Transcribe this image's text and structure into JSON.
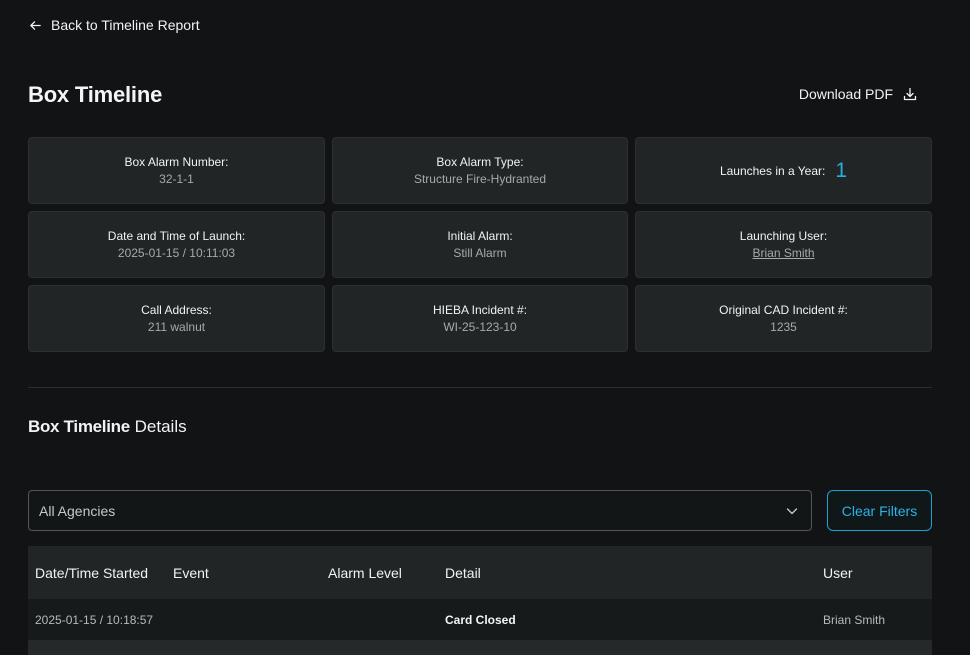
{
  "nav": {
    "back_label": "Back to Timeline Report"
  },
  "header": {
    "title": "Box Timeline",
    "download_label": "Download PDF"
  },
  "summary": {
    "box_alarm_number": {
      "label": "Box Alarm Number:",
      "value": "32-1-1"
    },
    "box_alarm_type": {
      "label": "Box Alarm Type:",
      "value": "Structure Fire-Hydranted"
    },
    "launches": {
      "label": "Launches in a Year:",
      "value": "1"
    },
    "launch_datetime": {
      "label": "Date and Time of Launch:",
      "value": "2025-01-15 / 10:11:03"
    },
    "initial_alarm": {
      "label": "Initial Alarm:",
      "value": "Still Alarm"
    },
    "launching_user": {
      "label": "Launching User:",
      "value": "Brian Smith"
    },
    "call_address": {
      "label": "Call Address:",
      "value": "211 walnut"
    },
    "hieba_incident": {
      "label": "HIEBA Incident #:",
      "value": "WI-25-123-10"
    },
    "cad_incident": {
      "label": "Original CAD Incident #:",
      "value": "1235"
    }
  },
  "details": {
    "title_bold": "Box Timeline",
    "title_rest": " Details"
  },
  "filters": {
    "agency_selected": "All Agencies",
    "clear_label": "Clear Filters"
  },
  "table": {
    "columns": {
      "started": "Date/Time Started",
      "event": "Event",
      "alarm_level": "Alarm Level",
      "detail": "Detail",
      "user": "User"
    },
    "rows": [
      {
        "started": "2025-01-15 / 10:18:57",
        "event": "",
        "alarm_level": "",
        "detail": "Card Closed",
        "user": "Brian Smith"
      }
    ]
  },
  "colors": {
    "accent": "#27aee0",
    "background": "#111314",
    "card": "#212526"
  }
}
